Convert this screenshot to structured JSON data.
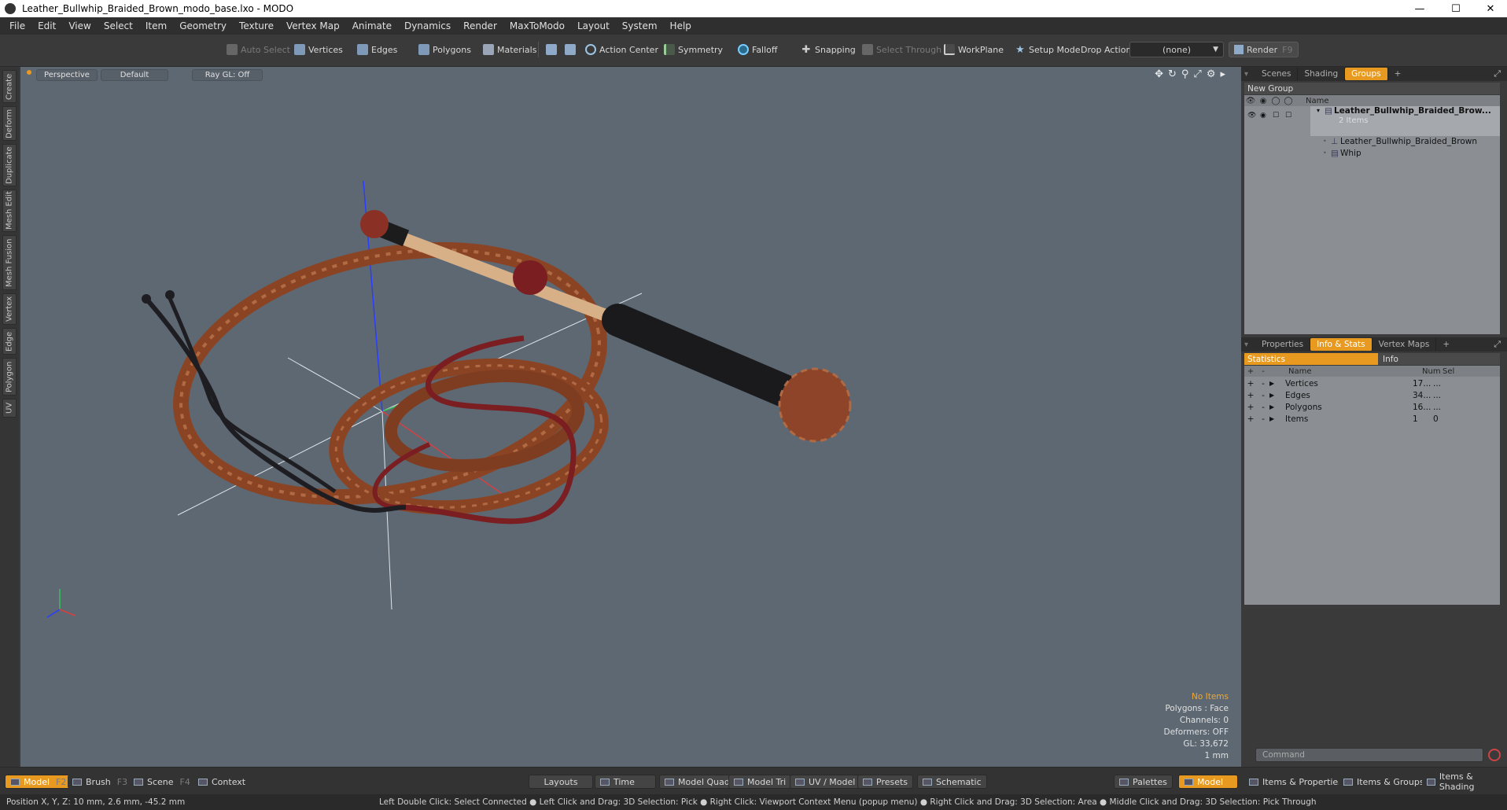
{
  "window": {
    "title": "Leather_Bullwhip_Braided_Brown_modo_base.lxo - MODO"
  },
  "menu": [
    "File",
    "Edit",
    "View",
    "Select",
    "Item",
    "Geometry",
    "Texture",
    "Vertex Map",
    "Animate",
    "Dynamics",
    "Render",
    "MaxToModo",
    "Layout",
    "System",
    "Help"
  ],
  "toolbar": {
    "auto_select": "Auto Select",
    "vertices": "Vertices",
    "edges": "Edges",
    "polygons": "Polygons",
    "materials": "Materials",
    "action_center": "Action Center",
    "symmetry": "Symmetry",
    "falloff": "Falloff",
    "snapping": "Snapping",
    "select_through": "Select Through",
    "workplane": "WorkPlane",
    "setup_mode": "Setup Mode",
    "drop_action": "Drop Action",
    "drop_value": "(none)",
    "render": "Render",
    "render_key": "F9"
  },
  "left_tabs": [
    "Create",
    "Deform",
    "Duplicate",
    "Mesh Edit",
    "Mesh Fusion",
    "Vertex",
    "Edge",
    "Polygon",
    "UV"
  ],
  "viewport": {
    "view": "Perspective",
    "shading": "Default",
    "raygl": "Ray GL: Off",
    "stats": {
      "items": "No Items",
      "polygons": "Polygons : Face",
      "channels": "Channels: 0",
      "deformers": "Deformers: OFF",
      "gl": "GL: 33,672",
      "unit": "1 mm"
    }
  },
  "scene_panel": {
    "tabs": [
      "Scenes",
      "Shading",
      "Groups"
    ],
    "active_tab": "Groups",
    "new_group": "New Group",
    "name_header": "Name",
    "group_name": "Leather_Bullwhip_Braided_Brow...",
    "group_count": "2 Items",
    "children": [
      "Leather_Bullwhip_Braided_Brown",
      "Whip"
    ]
  },
  "info_panel": {
    "tabs": [
      "Properties",
      "Info & Stats",
      "Vertex Maps"
    ],
    "active_tab": "Info & Stats",
    "sub_tabs": [
      "Statistics",
      "Info"
    ],
    "headers": {
      "name": "Name",
      "num": "Num",
      "sel": "Sel"
    },
    "rows": [
      {
        "name": "Vertices",
        "num": "17...",
        "sel": "..."
      },
      {
        "name": "Edges",
        "num": "34...",
        "sel": "..."
      },
      {
        "name": "Polygons",
        "num": "16...",
        "sel": "..."
      },
      {
        "name": "Items",
        "num": "1",
        "sel": "0"
      }
    ],
    "command_placeholder": "Command"
  },
  "bottom": {
    "model": "Model",
    "model_key": "F2",
    "brush": "Brush",
    "brush_key": "F3",
    "scene": "Scene",
    "scene_key": "F4",
    "context": "Context",
    "layouts": "Layouts",
    "time": "Time",
    "model_quad": "Model Quad",
    "model_tri": "Model Tri",
    "uv_model": "UV / Model",
    "presets": "Presets",
    "schematic": "Schematic",
    "palettes": "Palettes",
    "model2": "Model",
    "items_props": "Items & Properties",
    "items_groups": "Items & Groups",
    "items_shading": "Items & Shading"
  },
  "status": {
    "position": "Position X, Y, Z:   10 mm, 2.6 mm, -45.2 mm",
    "hints": "Left Double Click: Select Connected ● Left Click and Drag: 3D Selection: Pick ● Right Click: Viewport Context Menu (popup menu) ● Right Click and Drag: 3D Selection: Area ● Middle Click and Drag: 3D Selection: Pick Through"
  },
  "colors": {
    "accent": "#e89a20",
    "viewport_bg": "#5d6873",
    "leather": "#8a4424",
    "handle": "#d8b088"
  }
}
